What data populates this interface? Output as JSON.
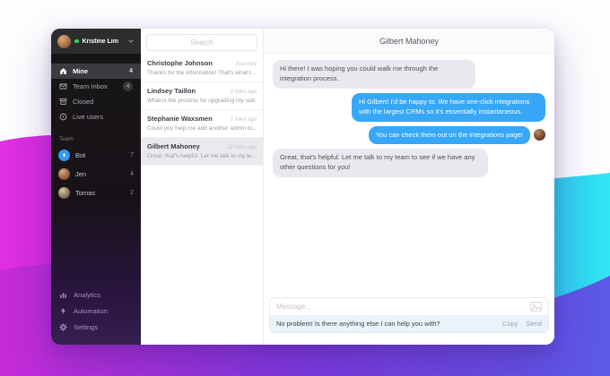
{
  "sidebar": {
    "user": {
      "name": "Kristine Lim",
      "status": "online",
      "chevron_icon": "chevron-down-icon"
    },
    "nav": [
      {
        "label": "Mine",
        "count": "4",
        "icon": "home-icon",
        "selected": true
      },
      {
        "label": "Team Inbox",
        "count": "4",
        "icon": "inbox-icon",
        "selected": false
      },
      {
        "label": "Closed",
        "count": "",
        "icon": "closed-archive-icon",
        "selected": false
      },
      {
        "label": "Live users",
        "count": "",
        "icon": "live-users-icon",
        "selected": false
      }
    ],
    "team_label": "Team",
    "team": [
      {
        "label": "Bot",
        "count": "7",
        "avatar": "bot-lightning-avatar"
      },
      {
        "label": "Jen",
        "count": "4",
        "avatar": "jen-avatar"
      },
      {
        "label": "Tomas",
        "count": "2",
        "avatar": "tomas-avatar"
      }
    ],
    "footer": [
      {
        "label": "Analytics",
        "icon": "analytics-icon"
      },
      {
        "label": "Automation",
        "icon": "automation-icon"
      },
      {
        "label": "Settings",
        "icon": "settings-icon"
      }
    ]
  },
  "conversations": {
    "search_placeholder": "Search",
    "items": [
      {
        "name": "Christophe Johnson",
        "time": "Just now",
        "preview": "Thanks for the information! That's what I...",
        "selected": false
      },
      {
        "name": "Lindsey Taillon",
        "time": "2 mins ago",
        "preview": "What is the process for upgrading my sub...",
        "selected": false
      },
      {
        "name": "Stephanie Waxsmen",
        "time": "7 mins ago",
        "preview": "Could you help me add another admin to...",
        "selected": false
      },
      {
        "name": "Gilbert Mahoney",
        "time": "22 mins ago",
        "preview": "Great, that's helpful. Let me talk to my te...",
        "selected": true
      }
    ]
  },
  "chat": {
    "title": "Gilbert Mahoney",
    "messages": [
      {
        "from": "visitor",
        "text": "Hi there! I was hoping you could walk me through the integration process."
      },
      {
        "from": "agent",
        "text": "Hi Gilbert! I'd be happy to. We have one-click integrations with the largest CRMs so it's essentially instantaneous."
      },
      {
        "from": "agent",
        "text": "You can check them out on the integrations page!",
        "has_avatar": true
      },
      {
        "from": "visitor",
        "text": "Great, that's helpful. Let me talk to my team to see if we have any other questions for you!"
      }
    ],
    "composer": {
      "placeholder": "Message...",
      "image_icon": "image-attach-icon"
    },
    "suggestion": {
      "text": "No problem! Is there anything else I can help you with?",
      "copy_label": "Copy",
      "send_label": "Send"
    }
  },
  "colors": {
    "accent_blue_bubble": "#37a7f8",
    "gradient_magenta": "#e02fe0",
    "gradient_purple": "#9a35e8",
    "gradient_cyan": "#2fe0f2",
    "gradient_indigo": "#5b5ae8",
    "sidebar_bg_top": "#171717",
    "sidebar_bg_bottom": "#35204f",
    "online_green": "#35d653",
    "suggestion_bg": "#e9f3fc"
  }
}
